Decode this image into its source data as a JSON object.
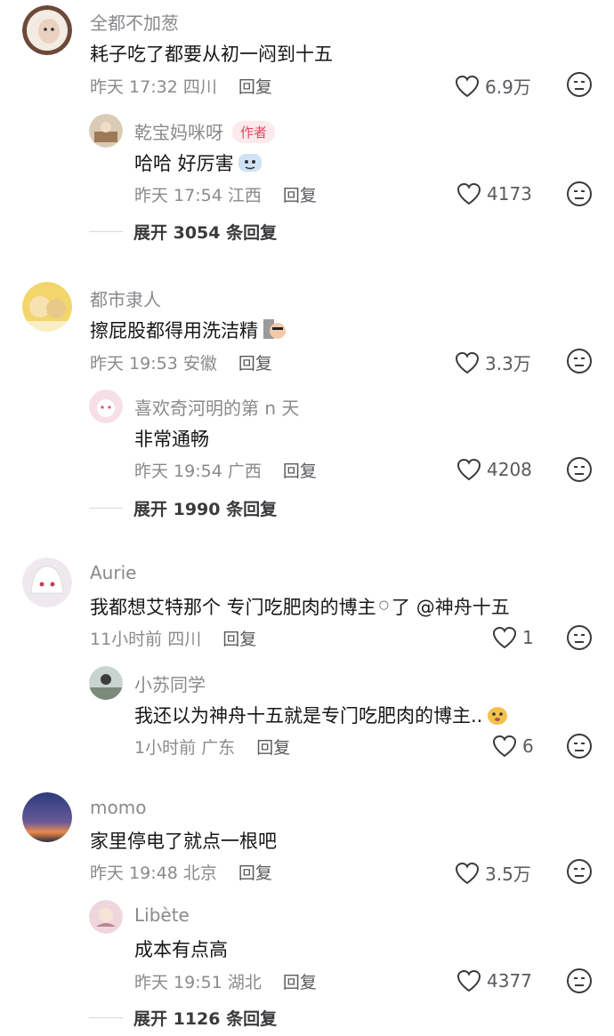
{
  "threads": [
    {
      "comment": {
        "user": "全都不加葱",
        "text": "耗子吃了都要从初一闷到十五",
        "time": "昨天 17:32",
        "location": "四川",
        "reply_label": "回复",
        "likes": "6.9万"
      },
      "reply": {
        "user": "乾宝妈咪呀",
        "badge": "作者",
        "text": "哈哈 好厉害",
        "time": "昨天 17:54",
        "location": "江西",
        "reply_label": "回复",
        "likes": "4173"
      },
      "expand_label": "展开 3054 条回复"
    },
    {
      "comment": {
        "user": "都市隶人",
        "text": "擦屁股都得用洗洁精",
        "time": "昨天 19:53",
        "location": "安徽",
        "reply_label": "回复",
        "likes": "3.3万"
      },
      "reply": {
        "user": "喜欢奇河明的第 n 天",
        "text": "非常通畅",
        "time": "昨天 19:54",
        "location": "广西",
        "reply_label": "回复",
        "likes": "4208"
      },
      "expand_label": "展开 1990 条回复"
    },
    {
      "comment": {
        "user": "Aurie",
        "text_before": "我都想艾特那个 专门吃肥肉的博主",
        "text_after": "了",
        "mention": "@神舟十五",
        "time": "11小时前",
        "location": "四川",
        "reply_label": "回复",
        "likes": "1"
      },
      "reply": {
        "user": "小苏同学",
        "text": "我还以为神舟十五就是专门吃肥肉的博主..",
        "time": "1小时前",
        "location": "广东",
        "reply_label": "回复",
        "likes": "6"
      }
    },
    {
      "comment": {
        "user": "momo",
        "text": "家里停电了就点一根吧",
        "time": "昨天 19:48",
        "location": "北京",
        "reply_label": "回复",
        "likes": "3.5万"
      },
      "reply": {
        "user": "Libète",
        "text": "成本有点高",
        "time": "昨天 19:51",
        "location": "湖北",
        "reply_label": "回复",
        "likes": "4377"
      },
      "expand_label": "展开 1126 条回复"
    }
  ],
  "colors": {
    "muted": "#8a8a8e",
    "badge_bg": "#fdeaee",
    "badge_text": "#e3455f"
  },
  "icons": [
    "heart-outline-icon",
    "dislike-face-icon",
    "search-mark-icon"
  ]
}
